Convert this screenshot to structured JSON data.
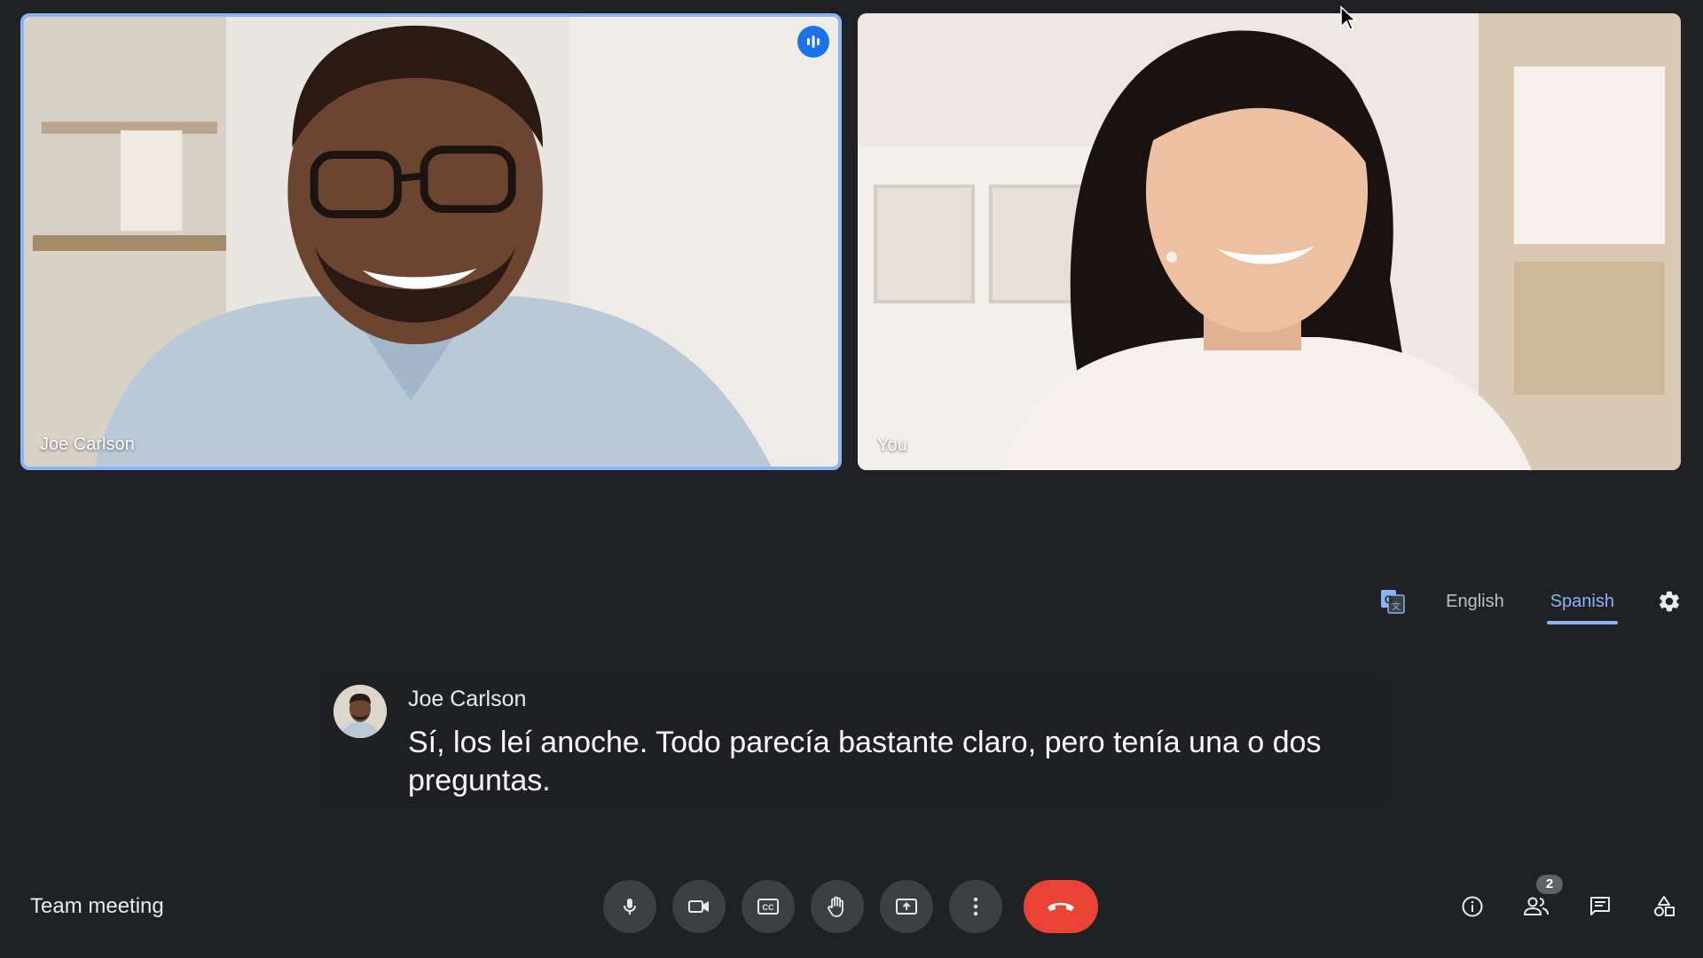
{
  "participants": [
    {
      "name": "Joe Carlson",
      "speaking": true
    },
    {
      "name": "You",
      "speaking": false
    }
  ],
  "captions": {
    "languages": [
      "English",
      "Spanish"
    ],
    "active_language": "Spanish",
    "speaker": "Joe Carlson",
    "text": "Sí, los leí anoche. Todo parecía bastante claro, pero tenía una o dos preguntas."
  },
  "meeting": {
    "title": "Team meeting"
  },
  "controls": [
    "microphone-icon",
    "camera-icon",
    "closed-captions-icon",
    "raise-hand-icon",
    "present-screen-icon",
    "more-options-icon",
    "end-call-icon"
  ],
  "tools": {
    "people_count": "2"
  },
  "colors": {
    "background": "#202124",
    "accent": "#8ab4f8",
    "hangup": "#ea4335",
    "button": "#3c4043"
  }
}
